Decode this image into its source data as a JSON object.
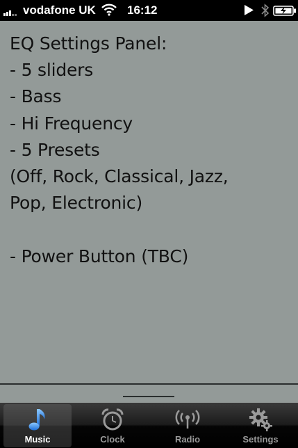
{
  "status_bar": {
    "carrier": "vodafone UK",
    "time": "16:12"
  },
  "note": {
    "lines": [
      "EQ Settings Panel:",
      "- 5 sliders",
      "- Bass",
      "- Hi Frequency",
      "- 5 Presets",
      "(Off, Rock, Classical, Jazz,",
      "Pop, Electronic)",
      "- Power Button (TBC)"
    ]
  },
  "tab_bar": {
    "tabs": [
      {
        "label": "Music",
        "icon": "music-note-icon",
        "active": true
      },
      {
        "label": "Clock",
        "icon": "alarm-clock-icon",
        "active": false
      },
      {
        "label": "Radio",
        "icon": "radio-antenna-icon",
        "active": false
      },
      {
        "label": "Settings",
        "icon": "gears-icon",
        "active": false
      }
    ]
  },
  "colors": {
    "background": "#939a98",
    "accent": "#3e8ee8",
    "tab_bar": "#000000"
  }
}
